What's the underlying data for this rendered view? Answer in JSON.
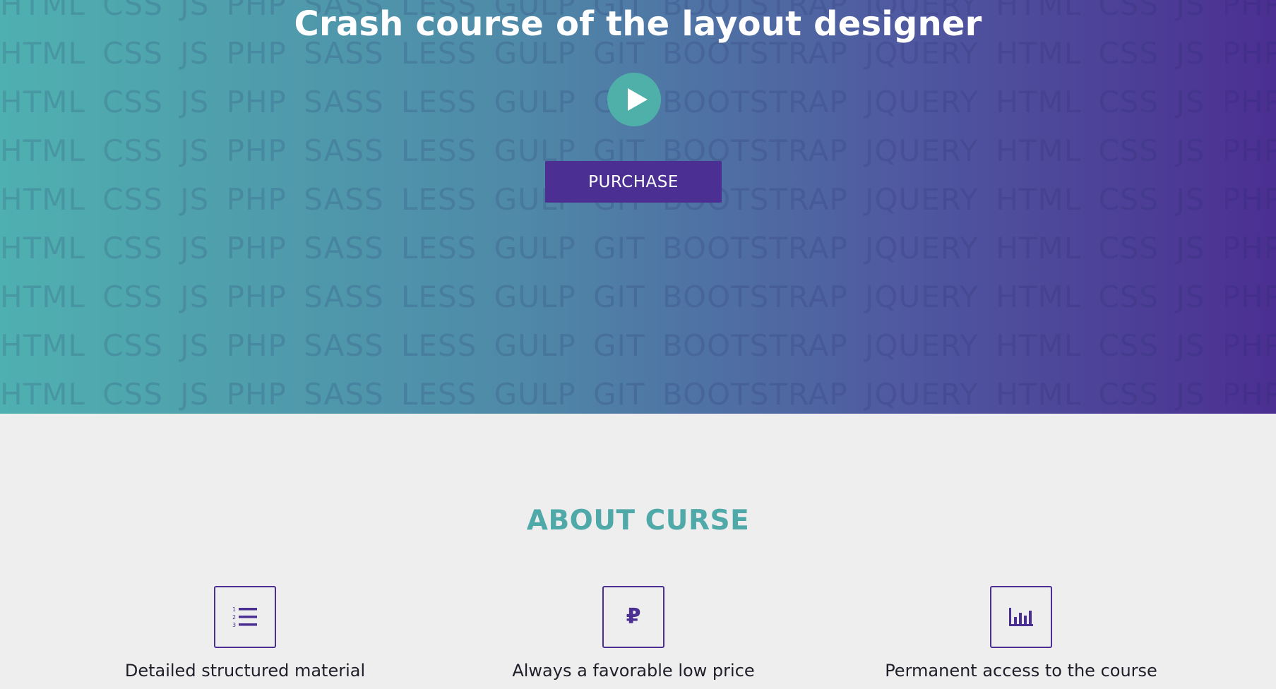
{
  "hero": {
    "title": "Crash course of the layout designer",
    "purchase_label": "PURCHASE",
    "background_words": [
      "HTML",
      "CSS",
      "JS",
      "PHP",
      "SASS",
      "LESS",
      "GULP",
      "GIT",
      "BOOTSTRAP",
      "JQUERY"
    ],
    "gradient_colors": [
      "#4fb0b0",
      "#4b2f92"
    ]
  },
  "about": {
    "title": "ABOUT CURSE",
    "features": [
      {
        "icon": "numbered-list-icon",
        "label": "Detailed structured material"
      },
      {
        "icon": "ruble-icon",
        "glyph": "₽",
        "label": "Always a favorable low price"
      },
      {
        "icon": "bar-chart-icon",
        "label": "Permanent access to the course"
      }
    ]
  },
  "colors": {
    "accent_purple": "#4b2f92",
    "accent_teal": "#4fa9a9",
    "page_background": "#eeeeee"
  }
}
